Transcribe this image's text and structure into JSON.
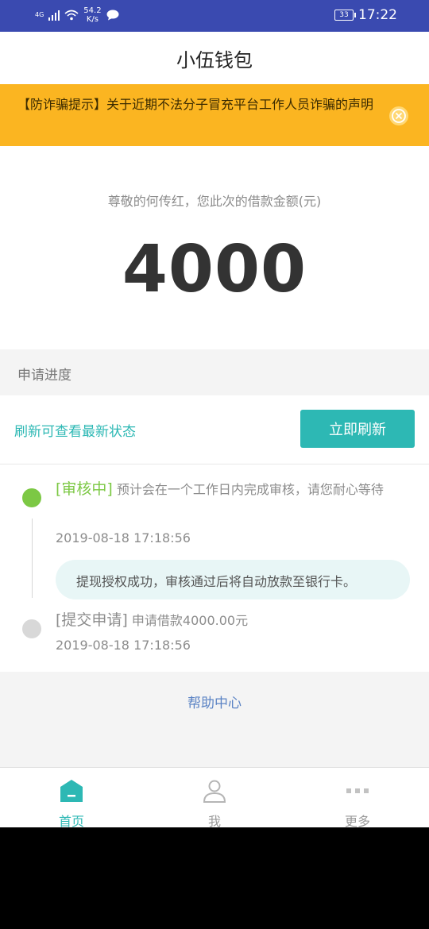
{
  "status_bar": {
    "network": "4G",
    "speed_value": "54.2",
    "speed_unit": "K/s",
    "battery": "33",
    "time": "17:22"
  },
  "header": {
    "title": "小伍钱包"
  },
  "notice": {
    "text": "【防诈骗提示】关于近期不法分子冒充平台工作人员诈骗的声明"
  },
  "amount": {
    "label": "尊敬的何传红，您此次的借款金额(元)",
    "value": "4000"
  },
  "progress": {
    "heading": "申请进度",
    "refresh_tip": "刷新可查看最新状态",
    "refresh_button": "立即刷新",
    "steps": [
      {
        "status": "[审核中]",
        "description": " 预计会在一个工作日内完成审核，请您耐心等待",
        "time": "2019-08-18 17:18:56",
        "note": "提现授权成功，审核通过后将自动放款至银行卡。"
      },
      {
        "status": "[提交申请]",
        "description": " 申请借款4000.00元",
        "time": "2019-08-18 17:18:56"
      }
    ]
  },
  "help_link": "帮助中心",
  "tabs": [
    {
      "label": "首页",
      "icon": "home-icon",
      "active": true
    },
    {
      "label": "我",
      "icon": "user-icon",
      "active": false
    },
    {
      "label": "更多",
      "icon": "more-icon",
      "active": false
    }
  ],
  "colors": {
    "accent": "#2db8b4",
    "notice_bg": "#fbb521",
    "status_active": "#7cc844",
    "status_bar": "#3a4ab0"
  }
}
